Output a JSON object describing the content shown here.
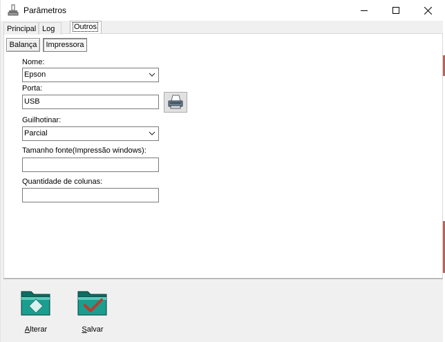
{
  "window": {
    "title": "Parâmetros"
  },
  "titlebar": {
    "minimize_icon": "minimize-icon",
    "maximize_icon": "maximize-icon",
    "close_icon": "close-icon"
  },
  "tabs": [
    {
      "label": "Principal"
    },
    {
      "label": "Log"
    },
    {
      "label": "Outros"
    }
  ],
  "subtabs": [
    {
      "label": "Balança"
    },
    {
      "label": "Impressora"
    }
  ],
  "form": {
    "nome_label": "Nome:",
    "nome_value": "Epson",
    "porta_label": "Porta:",
    "porta_value": "USB",
    "guilhotinar_label": "Guilhotinar:",
    "guilhotinar_value": "Parcial",
    "tamanho_label": "Tamanho fonte(Impressão windows):",
    "tamanho_value": "",
    "colunas_label": "Quantidade de colunas:",
    "colunas_value": ""
  },
  "footer": {
    "alterar_first": "A",
    "alterar_rest": "lterar",
    "salvar_first": "S",
    "salvar_rest": "alvar"
  },
  "colors": {
    "accent": "#1a9e8f",
    "check": "#c0392b"
  }
}
